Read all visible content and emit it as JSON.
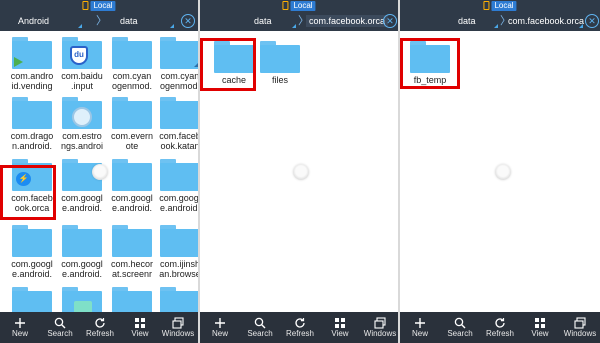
{
  "location_label": "Local",
  "nav_labels": {
    "new": "New",
    "search": "Search",
    "refresh": "Refresh",
    "view": "View",
    "windows": "Windows"
  },
  "panel1": {
    "crumbs": [
      "Android",
      "data"
    ],
    "items": [
      "com.andro\nid.vending",
      "com.baidu\n.input",
      "com.cyan\nogenmod.",
      "com.cyan\nogenmod.",
      "com.drago\nn.android.",
      "com.estro\nngs.androi",
      "com.evern\note",
      "com.faceb\nook.katan",
      "com.faceb\nook.orca",
      "com.googl\ne.android.",
      "com.googl\ne.android.",
      "com.googl\ne.android.",
      "com.googl\ne.android.",
      "com.googl\ne.android.",
      "com.hecor\nat.screenr",
      "com.ijinsh\nan.browse",
      "",
      "",
      "",
      ""
    ]
  },
  "panel2": {
    "crumbs": [
      "data",
      "com.facebook.orca"
    ],
    "items": [
      "cache",
      "files"
    ]
  },
  "panel3": {
    "crumbs": [
      "data",
      "com.facebook.orca"
    ],
    "items": [
      "fb_temp"
    ]
  }
}
